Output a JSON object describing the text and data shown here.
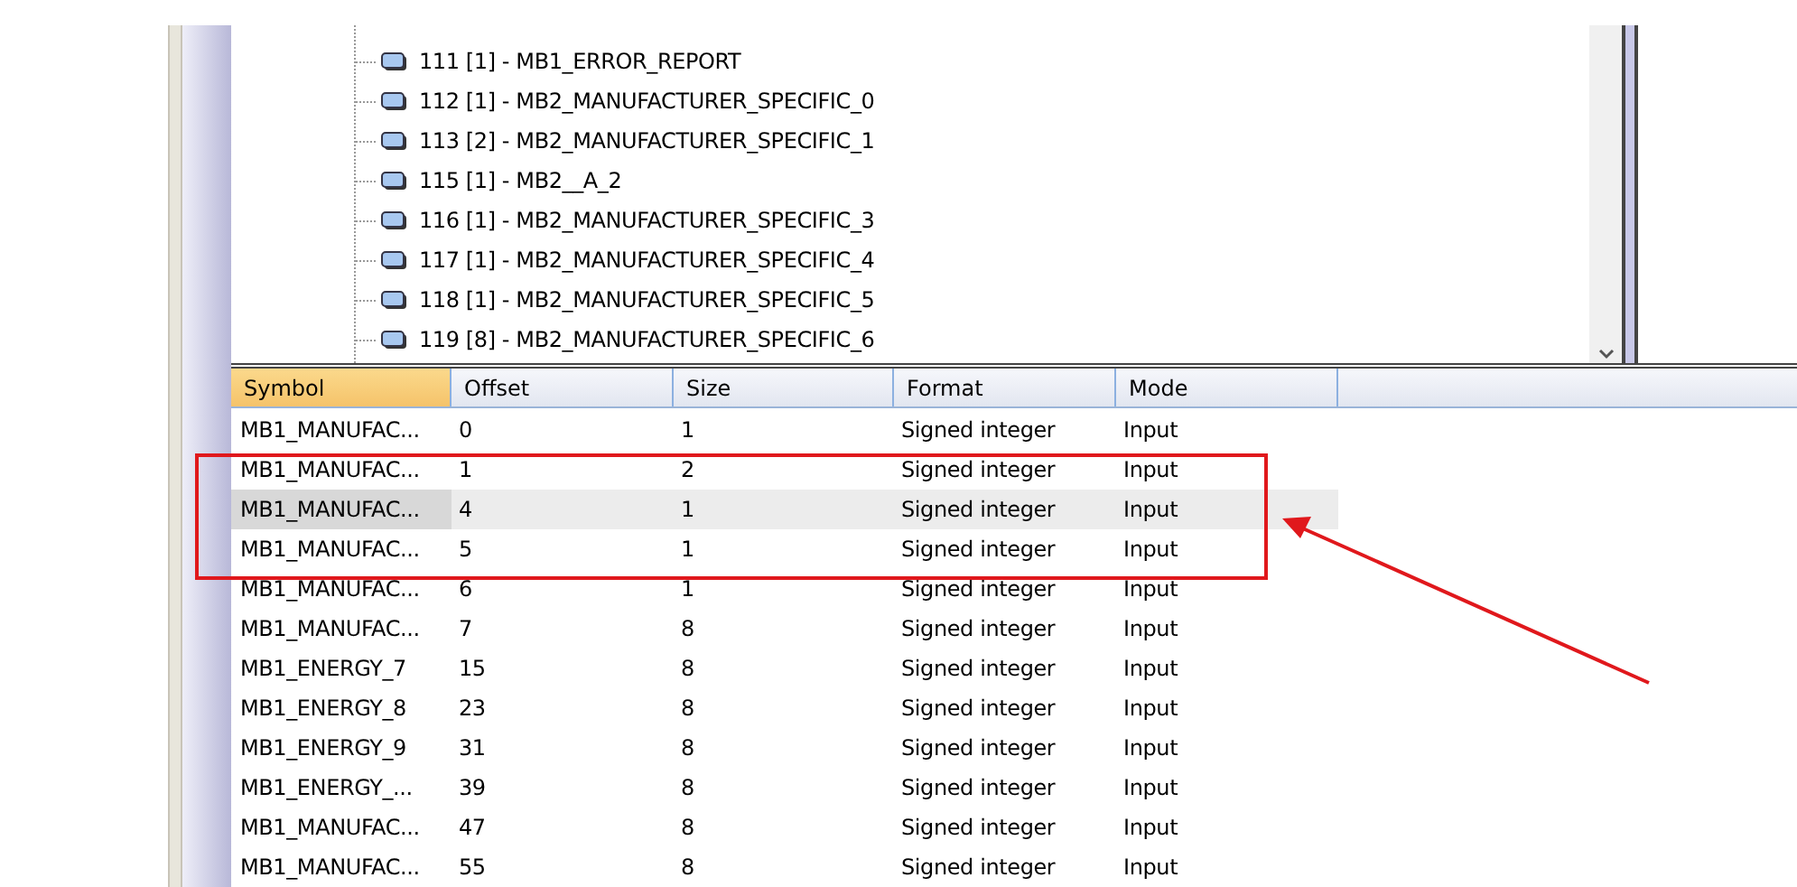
{
  "tree": {
    "items": [
      {
        "label": "111 [1] - MB1_ERROR_REPORT"
      },
      {
        "label": "112 [1] - MB2_MANUFACTURER_SPECIFIC_0"
      },
      {
        "label": "113 [2] - MB2_MANUFACTURER_SPECIFIC_1"
      },
      {
        "label": "115 [1] - MB2__A_2"
      },
      {
        "label": "116 [1] - MB2_MANUFACTURER_SPECIFIC_3"
      },
      {
        "label": "117 [1] - MB2_MANUFACTURER_SPECIFIC_4"
      },
      {
        "label": "118 [1] - MB2_MANUFACTURER_SPECIFIC_5"
      },
      {
        "label": "119 [8] - MB2_MANUFACTURER_SPECIFIC_6"
      }
    ]
  },
  "table": {
    "columns": [
      {
        "label": "Symbol",
        "selected": true
      },
      {
        "label": "Offset",
        "selected": false
      },
      {
        "label": "Size",
        "selected": false
      },
      {
        "label": "Format",
        "selected": false
      },
      {
        "label": "Mode",
        "selected": false
      }
    ],
    "rows": [
      {
        "cells": [
          "MB1_MANUFAC...",
          "0",
          "1",
          "Signed integer",
          "Input"
        ],
        "selected": false
      },
      {
        "cells": [
          "MB1_MANUFAC...",
          "1",
          "2",
          "Signed integer",
          "Input"
        ],
        "selected": false
      },
      {
        "cells": [
          "MB1_MANUFAC...",
          "4",
          "1",
          "Signed integer",
          "Input"
        ],
        "selected": true
      },
      {
        "cells": [
          "MB1_MANUFAC...",
          "5",
          "1",
          "Signed integer",
          "Input"
        ],
        "selected": false
      },
      {
        "cells": [
          "MB1_MANUFAC...",
          "6",
          "1",
          "Signed integer",
          "Input"
        ],
        "selected": false
      },
      {
        "cells": [
          "MB1_MANUFAC...",
          "7",
          "8",
          "Signed integer",
          "Input"
        ],
        "selected": false
      },
      {
        "cells": [
          "MB1_ENERGY_7",
          "15",
          "8",
          "Signed integer",
          "Input"
        ],
        "selected": false
      },
      {
        "cells": [
          "MB1_ENERGY_8",
          "23",
          "8",
          "Signed integer",
          "Input"
        ],
        "selected": false
      },
      {
        "cells": [
          "MB1_ENERGY_9",
          "31",
          "8",
          "Signed integer",
          "Input"
        ],
        "selected": false
      },
      {
        "cells": [
          "MB1_ENERGY_...",
          "39",
          "8",
          "Signed integer",
          "Input"
        ],
        "selected": false
      },
      {
        "cells": [
          "MB1_MANUFAC...",
          "47",
          "8",
          "Signed integer",
          "Input"
        ],
        "selected": false
      },
      {
        "cells": [
          "MB1_MANUFAC...",
          "55",
          "8",
          "Signed integer",
          "Input"
        ],
        "selected": false
      }
    ]
  }
}
